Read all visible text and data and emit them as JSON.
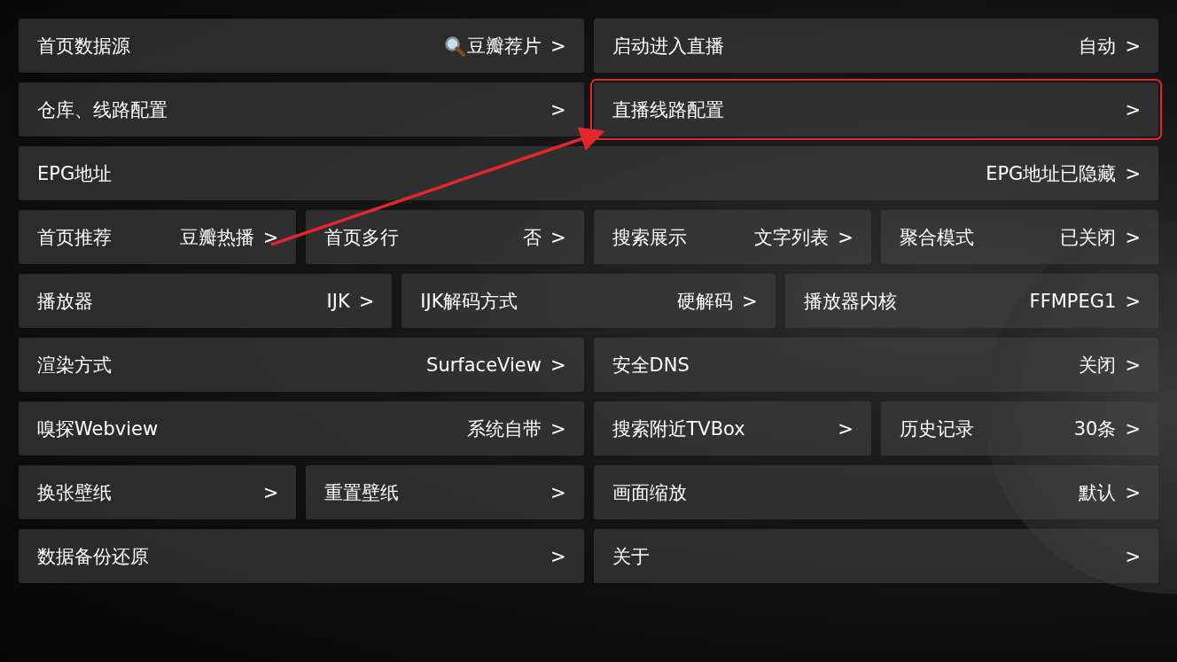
{
  "rows": [
    {
      "items": [
        {
          "label": "首页数据源",
          "value": "豆瓣荐片",
          "arrow": ">",
          "kind": "search",
          "highlighted": false
        },
        {
          "label": "启动进入直播",
          "value": "自动",
          "arrow": ">",
          "kind": "plain",
          "highlighted": false
        }
      ]
    },
    {
      "items": [
        {
          "label": "仓库、线路配置",
          "value": "",
          "arrow": ">",
          "kind": "plain",
          "highlighted": false
        },
        {
          "label": "直播线路配置",
          "value": "",
          "arrow": ">",
          "kind": "plain",
          "highlighted": true
        }
      ]
    },
    {
      "items": [
        {
          "label": "EPG地址",
          "value": "EPG地址已隐藏",
          "arrow": ">",
          "kind": "plain",
          "highlighted": false
        }
      ]
    },
    {
      "items": [
        {
          "label": "首页推荐",
          "value": "豆瓣热播",
          "arrow": ">",
          "kind": "plain",
          "highlighted": false
        },
        {
          "label": "首页多行",
          "value": "否",
          "arrow": ">",
          "kind": "plain",
          "highlighted": false
        },
        {
          "label": "搜索展示",
          "value": "文字列表",
          "arrow": ">",
          "kind": "plain",
          "highlighted": false
        },
        {
          "label": "聚合模式",
          "value": "已关闭",
          "arrow": ">",
          "kind": "plain",
          "highlighted": false
        }
      ]
    },
    {
      "items": [
        {
          "label": "播放器",
          "value": "IJK",
          "arrow": ">",
          "kind": "plain",
          "highlighted": false
        },
        {
          "label": "IJK解码方式",
          "value": "硬解码",
          "arrow": ">",
          "kind": "plain",
          "highlighted": false
        },
        {
          "label": "播放器内核",
          "value": "FFMPEG1",
          "arrow": ">",
          "kind": "plain",
          "highlighted": false
        }
      ]
    },
    {
      "items": [
        {
          "label": "渲染方式",
          "value": "SurfaceView",
          "arrow": ">",
          "kind": "plain",
          "highlighted": false
        },
        {
          "label": "安全DNS",
          "value": "关闭",
          "arrow": ">",
          "kind": "plain",
          "highlighted": false
        }
      ]
    },
    {
      "items": [
        {
          "label": "嗅探Webview",
          "value": "系统自带",
          "arrow": ">",
          "kind": "plain",
          "highlighted": false
        },
        {
          "label": "搜索附近TVBox",
          "value": "",
          "arrow": ">",
          "kind": "plain",
          "highlighted": false
        },
        {
          "label": "历史记录",
          "value": "30条",
          "arrow": ">",
          "kind": "plain",
          "highlighted": false
        }
      ]
    },
    {
      "items": [
        {
          "label": "换张壁纸",
          "value": "",
          "arrow": ">",
          "kind": "plain",
          "highlighted": false
        },
        {
          "label": "重置壁纸",
          "value": "",
          "arrow": ">",
          "kind": "plain",
          "highlighted": false
        },
        {
          "label": "画面缩放",
          "value": "默认",
          "arrow": ">",
          "kind": "plain",
          "highlighted": false
        }
      ]
    },
    {
      "items": [
        {
          "label": "数据备份还原",
          "value": "",
          "arrow": ">",
          "kind": "plain",
          "highlighted": false
        },
        {
          "label": "关于",
          "value": "",
          "arrow": ">",
          "kind": "plain",
          "highlighted": false
        }
      ]
    }
  ]
}
